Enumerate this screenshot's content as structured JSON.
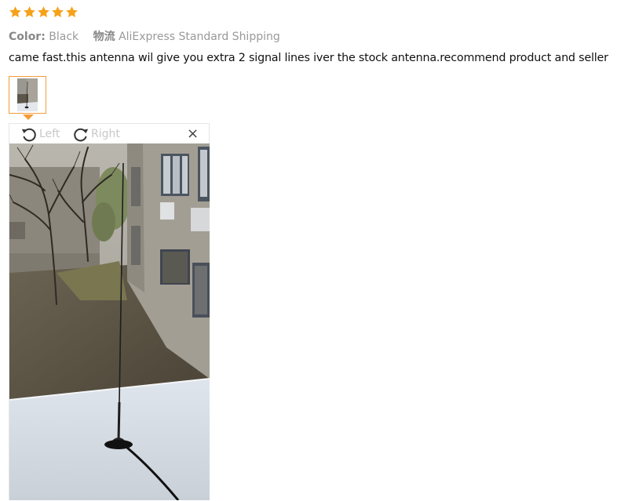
{
  "rating": {
    "stars": 5,
    "max": 5,
    "color": "#f5a21a"
  },
  "meta": {
    "color_label": "Color:",
    "color_value": "Black",
    "shipping_label": "物流",
    "shipping_value": "AliExpress Standard Shipping"
  },
  "review": {
    "text": "came fast.this antenna wil give you extra 2 signal lines iver the stock antenna.recommend product and seller"
  },
  "viewer": {
    "rotate_left_label": "Left",
    "rotate_right_label": "Right",
    "close_symbol": "×"
  },
  "icons": {
    "star": "star-icon",
    "rotate_left": "rotate-left-icon",
    "rotate_right": "rotate-right-icon",
    "close": "close-icon"
  },
  "colors": {
    "accent": "#f39c3a",
    "muted": "#999999"
  }
}
